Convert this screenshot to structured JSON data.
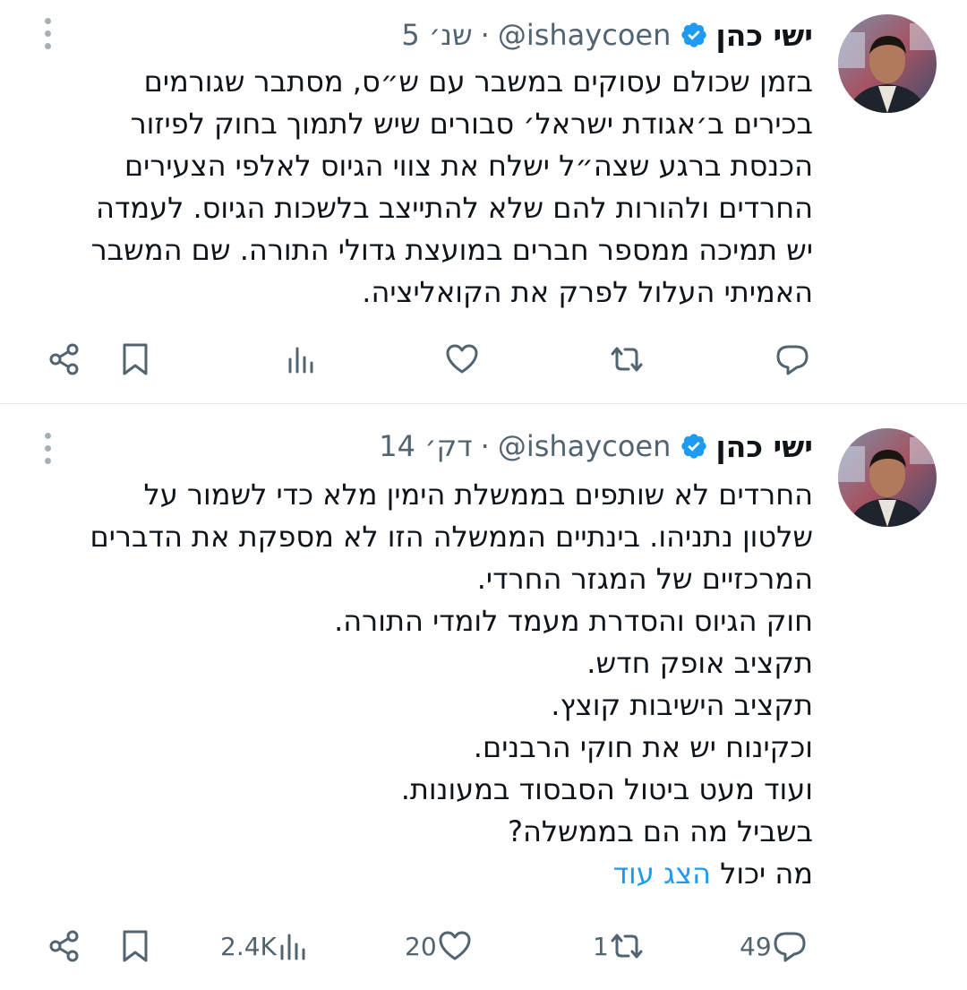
{
  "colors": {
    "accent": "#1d9bf0",
    "icon": "#536471",
    "text": "#0f1419",
    "divider": "#e5e9ec"
  },
  "tweets": [
    {
      "author": "ישי כהן",
      "handle": "@ishaycoen",
      "separator": "·",
      "time": "5 שנ׳",
      "verified_icon": "verified-badge-icon",
      "body_lines": [
        "בזמן שכולם עסוקים במשבר עם ש״ס, מסתבר שגורמים",
        "בכירים ב׳אגודת ישראל׳ סבורים שיש לתמוך בחוק לפיזור",
        "הכנסת ברגע שצה״ל ישלח את צווי הגיוס לאלפי הצעירים",
        "החרדים ולהורות להם שלא להתייצב בלשכות הגיוס. לעמדה",
        "יש תמיכה ממספר חברים במועצת גדולי התורה. שם המשבר",
        "האמיתי העלול לפרק את הקואליציה."
      ],
      "actions": {
        "reply": "",
        "retweet": "",
        "like": "",
        "views": ""
      }
    },
    {
      "author": "ישי כהן",
      "handle": "@ishaycoen",
      "separator": "·",
      "time": "14 דק׳",
      "verified_icon": "verified-badge-icon",
      "body_lines": [
        "החרדים לא שותפים בממשלת הימין מלא כדי לשמור על",
        "שלטון נתניהו. בינתיים הממשלה הזו לא מספקת את הדברים",
        "המרכזיים של המגזר החרדי.",
        "חוק הגיוס והסדרת מעמד לומדי התורה.",
        "תקציב אופק חדש.",
        "תקציב הישיבות קוצץ.",
        "וכקינוח יש את חוקי הרבנים.",
        "ועוד מעט ביטול הסבסוד במעונות.",
        "בשביל מה הם בממשלה?"
      ],
      "last_line_text": "מה יכול",
      "show_more": "הצג עוד",
      "actions": {
        "reply": "49",
        "retweet": "1",
        "like": "20",
        "views": "2.4K"
      }
    }
  ]
}
